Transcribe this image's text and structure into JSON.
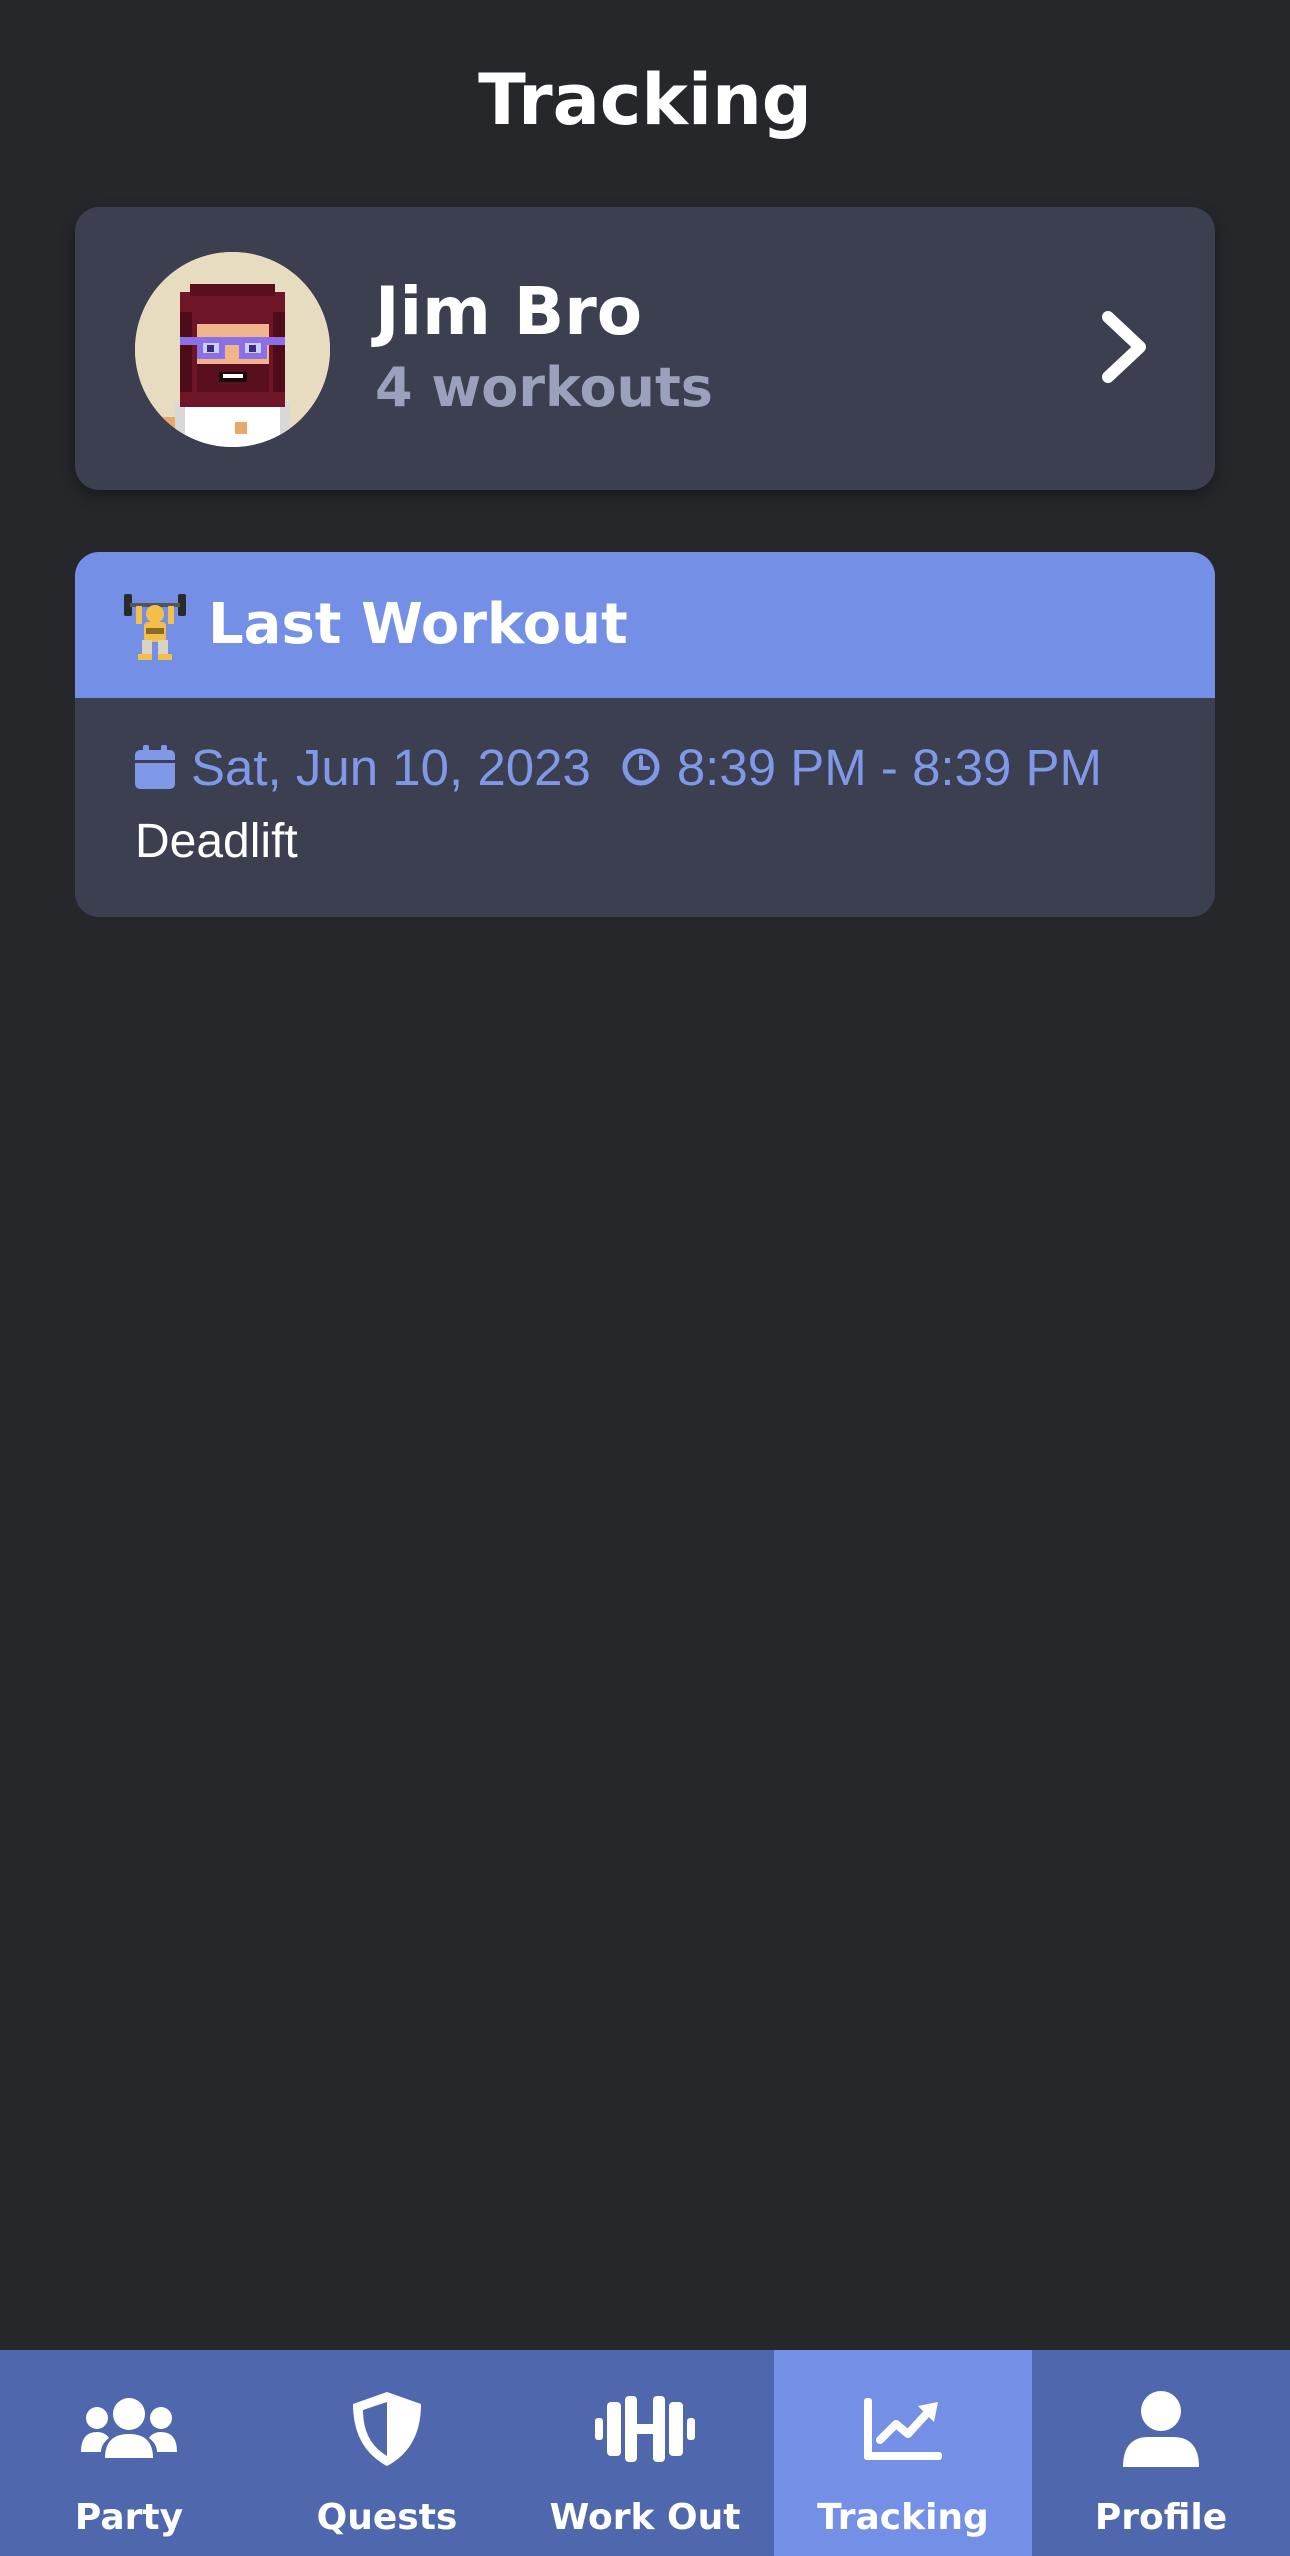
{
  "header": {
    "title": "Tracking"
  },
  "user_card": {
    "name": "Jim Bro",
    "workouts": "4 workouts",
    "avatar": "pixel-avatar",
    "action_icon": "chevron-right-icon"
  },
  "last_workout": {
    "icon": "weight-lifter-emoji",
    "title": "Last Workout",
    "date_icon": "calendar-icon",
    "date": "Sat, Jun 10, 2023",
    "time_icon": "clock-icon",
    "time": "8:39 PM - 8:39 PM",
    "exercise": "Deadlift"
  },
  "nav": {
    "items": [
      {
        "label": "Party",
        "icon": "users-icon",
        "active": false
      },
      {
        "label": "Quests",
        "icon": "shield-icon",
        "active": false
      },
      {
        "label": "Work Out",
        "icon": "dumbbell-icon",
        "active": false
      },
      {
        "label": "Tracking",
        "icon": "chart-line-icon",
        "active": true
      },
      {
        "label": "Profile",
        "icon": "user-icon",
        "active": false
      }
    ]
  },
  "colors": {
    "background": "#26272b",
    "card": "#3c3f50",
    "accent": "#7390e6",
    "nav_background": "#4f68ad",
    "secondary_text": "#9ba0bd",
    "meta_text": "#7f98e8"
  }
}
